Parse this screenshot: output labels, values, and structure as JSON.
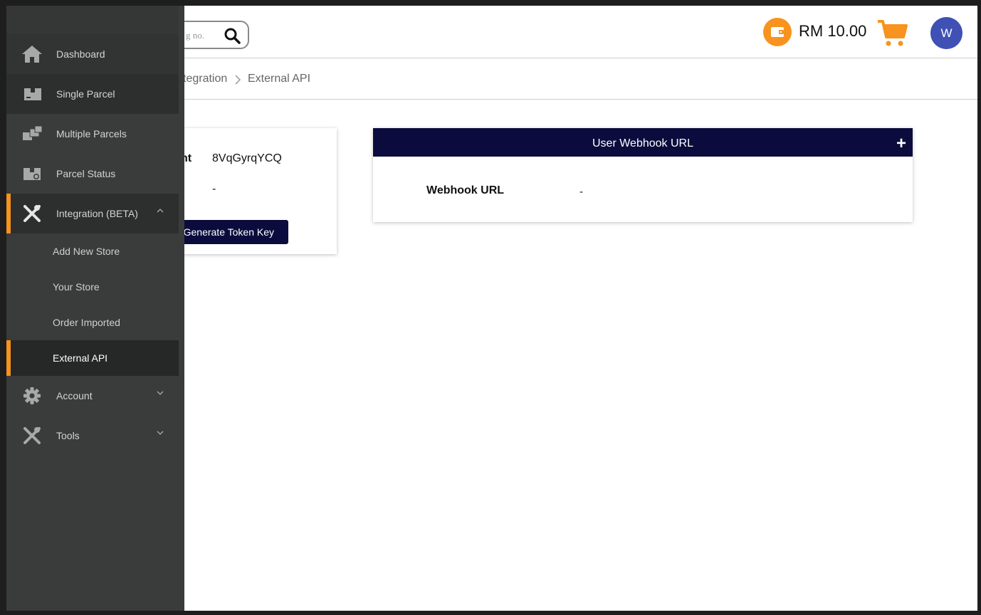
{
  "header": {
    "search_placeholder": "g no.",
    "balance": "RM 10.00",
    "avatar_initial": "W"
  },
  "breadcrumb": {
    "items": [
      "tegration",
      "External API"
    ],
    "separator": ">"
  },
  "api_card": {
    "label": "nt",
    "value1": "8VqGyrqYCQ",
    "value2": "-",
    "button": "Generate Token Key"
  },
  "webhook_card": {
    "title": "User Webhook URL",
    "add_symbol": "+",
    "field_label": "Webhook URL",
    "field_value": "-"
  },
  "sidebar": {
    "items": [
      {
        "label": "Dashboard",
        "icon": "home-icon"
      },
      {
        "label": "Single Parcel",
        "icon": "box-icon"
      },
      {
        "label": "Multiple Parcels",
        "icon": "boxes-icon"
      },
      {
        "label": "Parcel Status",
        "icon": "parcel-status-icon"
      },
      {
        "label": "Integration (BETA)",
        "icon": "tools-icon"
      },
      {
        "label": "Account",
        "icon": "gear-icon"
      },
      {
        "label": "Tools",
        "icon": "tools-icon"
      }
    ],
    "subitems": [
      "Add New Store",
      "Your Store",
      "Order Imported",
      "External API"
    ]
  },
  "colors": {
    "accent": "#f7931e",
    "navy": "#0b0c3d",
    "sidebar_bg": "#3a3b3b",
    "avatar_bg": "#3f51b5"
  }
}
